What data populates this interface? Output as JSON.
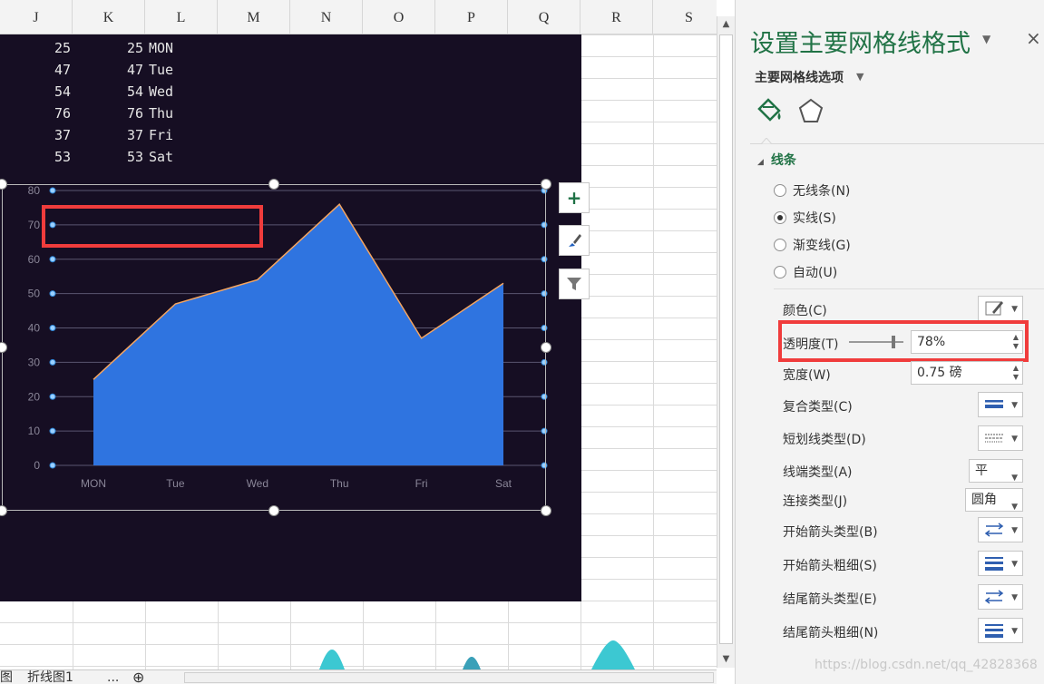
{
  "sheet": {
    "columns": [
      "J",
      "K",
      "L",
      "M",
      "N",
      "O",
      "P",
      "Q",
      "R",
      "S"
    ],
    "rows": [
      {
        "j": "25",
        "k": "25",
        "day": "MON"
      },
      {
        "j": "47",
        "k": "47",
        "day": "Tue"
      },
      {
        "j": "54",
        "k": "54",
        "day": "Wed"
      },
      {
        "j": "76",
        "k": "76",
        "day": "Thu"
      },
      {
        "j": "37",
        "k": "37",
        "day": "Fri"
      },
      {
        "j": "53",
        "k": "53",
        "day": "Sat"
      }
    ],
    "tabs": {
      "partial_left": "图",
      "active": "折线图1",
      "more": "...",
      "add": "⊕"
    }
  },
  "chart_data": {
    "type": "area",
    "categories": [
      "MON",
      "Tue",
      "Wed",
      "Thu",
      "Fri",
      "Sat"
    ],
    "values": [
      25,
      47,
      54,
      76,
      37,
      53
    ],
    "y_ticks": [
      "0",
      "10",
      "20",
      "30",
      "40",
      "50",
      "60",
      "70",
      "80"
    ],
    "ylim": [
      0,
      80
    ],
    "grid": true,
    "fill_color": "#2f74e0",
    "line_color": "#f4a460",
    "gridline_color": "#5a5670",
    "background": "#160e23"
  },
  "chart_buttons": {
    "add": "+",
    "style": "brush",
    "filter": "funnel"
  },
  "pane": {
    "title": "设置主要网格线格式",
    "close": "×",
    "subtitle": "主要网格线选项",
    "section": "线条",
    "radios": [
      {
        "label": "无线条(N)",
        "checked": false
      },
      {
        "label": "实线(S)",
        "checked": true
      },
      {
        "label": "渐变线(G)",
        "checked": false
      },
      {
        "label": "自动(U)",
        "checked": false
      }
    ],
    "props": {
      "color": "颜色(C)",
      "transparency": "透明度(T)",
      "transparency_value": "78%",
      "transparency_level": 0.78,
      "width": "宽度(W)",
      "width_value": "0.75 磅",
      "compound": "复合类型(C)",
      "dash": "短划线类型(D)",
      "cap": "线端类型(A)",
      "cap_value": "平",
      "join": "连接类型(J)",
      "join_value": "圆角",
      "begin_arrow_type": "开始箭头类型(B)",
      "begin_arrow_size": "开始箭头粗细(S)",
      "end_arrow_type": "结尾箭头类型(E)",
      "end_arrow_size": "结尾箭头粗细(N)"
    },
    "watermark": "https://blog.csdn.net/qq_42828368"
  },
  "colors": {
    "accent_green": "#217346",
    "highlight_red": "#f03c3c"
  }
}
